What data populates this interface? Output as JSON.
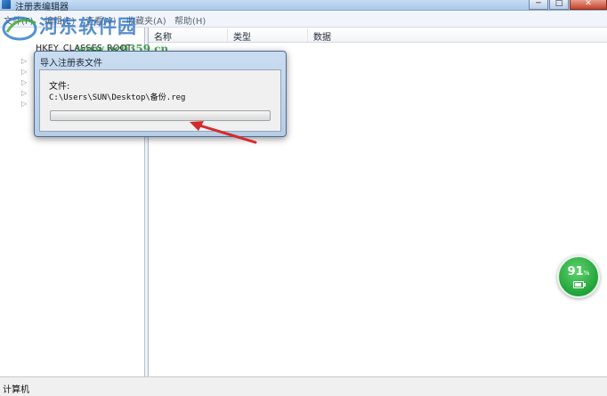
{
  "window": {
    "title": "注册表编辑器",
    "controls": {
      "minimize": "─",
      "maximize": "□",
      "close": "✕"
    }
  },
  "menu": {
    "items": [
      "文件(F)",
      "编辑(E)",
      "查看(V)",
      "收藏夹(A)",
      "帮助(H)"
    ]
  },
  "tree": {
    "root": "HKEY_CLASSES_ROOT",
    "computer_label": "计算机"
  },
  "list": {
    "columns": [
      "名称",
      "类型",
      "数据"
    ]
  },
  "dialog": {
    "title": "导入注册表文件",
    "file_label": "文件:",
    "file_path": "C:\\Users\\SUN\\Desktop\\备份.reg",
    "progress": 0
  },
  "statusbar": {
    "text": "计算机"
  },
  "watermark": {
    "brand": "河东软件园",
    "url": "www.pc0359.cn"
  },
  "battery_widget": {
    "value": "91",
    "unit": "%",
    "level": 0.91
  },
  "colors": {
    "progress_fill": "#4cb13a",
    "arrow": "#d42a2a",
    "battery": "#20a339"
  }
}
